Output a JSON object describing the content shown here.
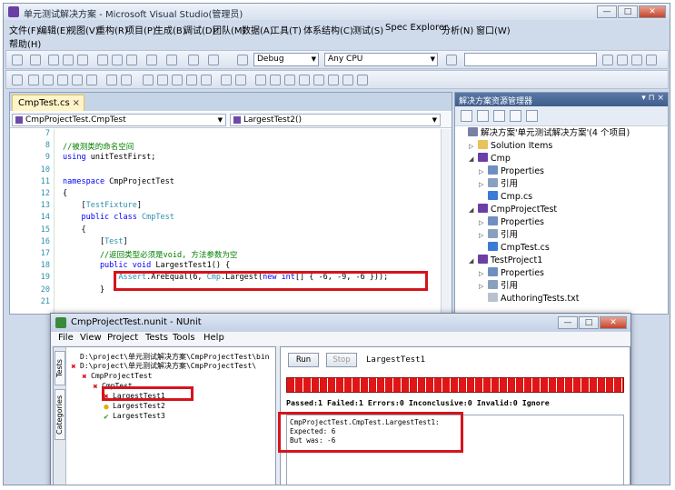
{
  "window": {
    "title": "单元测试解决方案 - Microsoft Visual Studio(管理员)",
    "min": "—",
    "max": "□",
    "close": "✕"
  },
  "menu": {
    "row1": [
      "文件(F)",
      "编辑(E)",
      "视图(V)",
      "重构(R)",
      "项目(P)",
      "生成(B)",
      "调试(D)",
      "团队(M)",
      "数据(A)",
      "工具(T)",
      "体系结构(C)",
      "测试(S)",
      "Spec Explorer",
      "分析(N)",
      "窗口(W)"
    ],
    "row2": [
      "帮助(H)"
    ]
  },
  "toolbar": {
    "config": "Debug",
    "platform": "Any CPU"
  },
  "editor": {
    "tab": "CmpTest.cs",
    "tab_close": "×",
    "nav_left": "CmpProjectTest.CmpTest",
    "nav_right": "LargestTest2()",
    "lines": [
      {
        "no": "7",
        "parts": []
      },
      {
        "no": "8",
        "parts": [
          {
            "t": "//被测类的命名空间",
            "c": "cm"
          }
        ]
      },
      {
        "no": "9",
        "parts": [
          {
            "t": "using",
            "c": "kw"
          },
          {
            "t": " unitTestFirst;",
            "c": ""
          }
        ]
      },
      {
        "no": "10",
        "parts": []
      },
      {
        "no": "11",
        "parts": [
          {
            "t": "namespace",
            "c": "kw"
          },
          {
            "t": " CmpProjectTest",
            "c": ""
          }
        ]
      },
      {
        "no": "12",
        "parts": [
          {
            "t": "{",
            "c": ""
          }
        ]
      },
      {
        "no": "13",
        "parts": [
          {
            "t": "    [",
            "c": ""
          },
          {
            "t": "TestFixture",
            "c": "ty"
          },
          {
            "t": "]",
            "c": ""
          }
        ]
      },
      {
        "no": "14",
        "parts": [
          {
            "t": "    public class ",
            "c": "kw"
          },
          {
            "t": "CmpTest",
            "c": "ty"
          }
        ]
      },
      {
        "no": "15",
        "parts": [
          {
            "t": "    {",
            "c": ""
          }
        ]
      },
      {
        "no": "16",
        "parts": [
          {
            "t": "        [",
            "c": ""
          },
          {
            "t": "Test",
            "c": "ty"
          },
          {
            "t": "]",
            "c": ""
          }
        ]
      },
      {
        "no": "17",
        "parts": [
          {
            "t": "        //返回类型必须是void, 方法参数为空",
            "c": "cm"
          }
        ]
      },
      {
        "no": "18",
        "parts": [
          {
            "t": "        public void ",
            "c": "kw"
          },
          {
            "t": "LargestTest1() {",
            "c": ""
          }
        ]
      },
      {
        "no": "19",
        "parts": [
          {
            "t": "            ",
            "c": ""
          },
          {
            "t": "Assert",
            "c": "ty"
          },
          {
            "t": ".AreEqual(6, ",
            "c": ""
          },
          {
            "t": "Cmp",
            "c": "ty"
          },
          {
            "t": ".Largest(",
            "c": ""
          },
          {
            "t": "new int",
            "c": "kw"
          },
          {
            "t": "[] { -6, -9, -6 }));",
            "c": ""
          }
        ]
      },
      {
        "no": "20",
        "parts": [
          {
            "t": "        }",
            "c": ""
          }
        ]
      },
      {
        "no": "21",
        "parts": []
      }
    ]
  },
  "solution": {
    "title": "解决方案资源管理器",
    "pin": "▾ ⊓ ×",
    "items": [
      {
        "label": "解决方案'单元测试解决方案'(4 个项目)",
        "indent": 0,
        "icon": "solution",
        "arrow": ""
      },
      {
        "label": "Solution Items",
        "indent": 1,
        "icon": "folder",
        "arrow": "▷"
      },
      {
        "label": "Cmp",
        "indent": 1,
        "icon": "project",
        "arrow": "◢"
      },
      {
        "label": "Properties",
        "indent": 2,
        "icon": "properties",
        "arrow": "▷"
      },
      {
        "label": "引用",
        "indent": 2,
        "icon": "references",
        "arrow": "▷"
      },
      {
        "label": "Cmp.cs",
        "indent": 2,
        "icon": "csfile",
        "arrow": ""
      },
      {
        "label": "CmpProjectTest",
        "indent": 1,
        "icon": "project",
        "arrow": "◢"
      },
      {
        "label": "Properties",
        "indent": 2,
        "icon": "properties",
        "arrow": "▷"
      },
      {
        "label": "引用",
        "indent": 2,
        "icon": "references",
        "arrow": "▷"
      },
      {
        "label": "CmpTest.cs",
        "indent": 2,
        "icon": "csfile",
        "arrow": ""
      },
      {
        "label": "TestProject1",
        "indent": 1,
        "icon": "project",
        "arrow": "◢"
      },
      {
        "label": "Properties",
        "indent": 2,
        "icon": "properties",
        "arrow": "▷"
      },
      {
        "label": "引用",
        "indent": 2,
        "icon": "references",
        "arrow": "▷"
      },
      {
        "label": "AuthoringTests.txt",
        "indent": 2,
        "icon": "textfile",
        "arrow": ""
      }
    ]
  },
  "nunit": {
    "title": "CmpProjectTest.nunit - NUnit",
    "menu": [
      "File",
      "View",
      "Project",
      "Tests",
      "Tools",
      "Help"
    ],
    "side_tabs": {
      "tests": "Tests",
      "categories": "Categories"
    },
    "tree": [
      {
        "text": "D:\\project\\单元测试解决方案\\CmpProjectTest\\bin",
        "indent": 0,
        "status": ""
      },
      {
        "text": "D:\\project\\单元测试解决方案\\CmpProjectTest\\",
        "indent": 0,
        "status": "fail"
      },
      {
        "text": "CmpProjectTest",
        "indent": 1,
        "status": "fail"
      },
      {
        "text": "CmpTest",
        "indent": 2,
        "status": "fail"
      },
      {
        "text": "LargestTest1",
        "indent": 3,
        "status": "fail"
      },
      {
        "text": "LargestTest2",
        "indent": 3,
        "status": "ignored"
      },
      {
        "text": "LargestTest3",
        "indent": 3,
        "status": "pass"
      }
    ],
    "run": "Run",
    "stop": "Stop",
    "current_test": "LargestTest1",
    "stats": "Passed:1 Failed:1 Errors:0 Inconclusive:0 Invalid:0 Ignore",
    "output": [
      "CmpProjectTest.CmpTest.LargestTest1:",
      "  Expected: 6",
      "  But was:  -6"
    ],
    "colors": {
      "fail": "#d4141c",
      "pass": "#2e9a2e",
      "ignored": "#d9b100"
    }
  }
}
